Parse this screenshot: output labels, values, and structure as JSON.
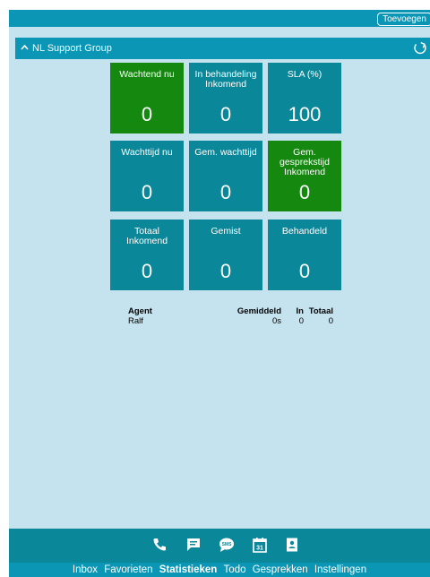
{
  "topbar": {
    "add_label": "Toevoegen"
  },
  "group": {
    "title": "NL Support Group"
  },
  "tiles": [
    {
      "label": "Wachtend nu",
      "value": "0",
      "color": "#15880f"
    },
    {
      "label": "In behandeling\nInkomend",
      "value": "0",
      "color": "#0a8799"
    },
    {
      "label": "SLA (%)",
      "value": "100",
      "color": "#0a8799"
    },
    {
      "label": "Wachttijd nu",
      "value": "0",
      "color": "#0a8799"
    },
    {
      "label": "Gem. wachttijd",
      "value": "0",
      "color": "#0a8799"
    },
    {
      "label": "Gem.\ngesprekstijd\nInkomend",
      "value": "0",
      "color": "#15880f"
    },
    {
      "label": "Totaal\nInkomend",
      "value": "0",
      "color": "#0a8799"
    },
    {
      "label": "Gemist",
      "value": "0",
      "color": "#0a8799"
    },
    {
      "label": "Behandeld",
      "value": "0",
      "color": "#0a8799"
    }
  ],
  "agent_table": {
    "headers": {
      "agent": "Agent",
      "average": "Gemiddeld",
      "in": "In",
      "total": "Totaal"
    },
    "rows": [
      {
        "agent": "Ralf",
        "average": "0s",
        "in": "0",
        "total": "0"
      }
    ]
  },
  "bottom_icons": [
    "phone-icon",
    "chat-icon",
    "sms-icon",
    "calendar-icon",
    "contacts-icon"
  ],
  "calendar_day": "31",
  "sms_text": "SMS",
  "nav": [
    {
      "label": "Inbox",
      "active": false
    },
    {
      "label": "Favorieten",
      "active": false
    },
    {
      "label": "Statistieken",
      "active": true
    },
    {
      "label": "Todo",
      "active": false
    },
    {
      "label": "Gesprekken",
      "active": false
    },
    {
      "label": "Instellingen",
      "active": false
    }
  ],
  "colors": {
    "background": "#c5e3ee",
    "header": "#0a96b4",
    "tile": "#0a8799",
    "tile_green": "#15880f"
  }
}
